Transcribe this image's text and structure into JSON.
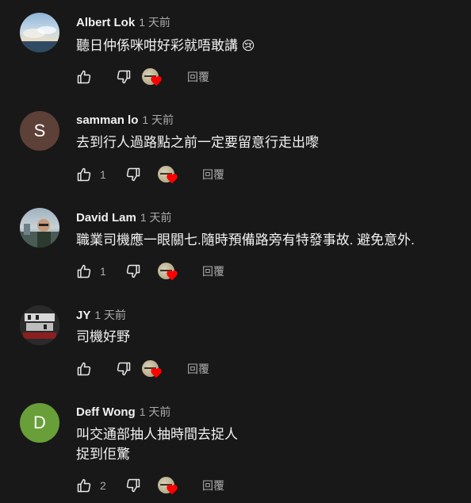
{
  "comments": [
    {
      "author": "Albert Lok",
      "time": "1 天前",
      "text_lines": [
        "聽日仲係咪咁好彩就唔敢講"
      ],
      "emoji": "😢",
      "likes": "",
      "avatar_letter": "",
      "reply_label": "回覆"
    },
    {
      "author": "samman lo",
      "time": "1 天前",
      "text_lines": [
        "去到行人過路點之前一定要留意行走出嚟"
      ],
      "emoji": "",
      "likes": "1",
      "avatar_letter": "S",
      "avatar_color": "#5d4037",
      "reply_label": "回覆"
    },
    {
      "author": "David Lam",
      "time": "1 天前",
      "text_lines": [
        "職業司機應一眼關七.隨時預備路旁有特發事故. 避免意外."
      ],
      "emoji": "",
      "likes": "1",
      "avatar_letter": "",
      "reply_label": "回覆"
    },
    {
      "author": "JY",
      "time": "1 天前",
      "text_lines": [
        "司機好野"
      ],
      "emoji": "",
      "likes": "",
      "avatar_letter": "",
      "reply_label": "回覆"
    },
    {
      "author": "Deff Wong",
      "time": "1 天前",
      "text_lines": [
        "叫交通部抽人抽時間去捉人",
        "捉到佢驚"
      ],
      "emoji": "",
      "likes": "2",
      "avatar_letter": "D",
      "avatar_color": "#689f38",
      "reply_label": "回覆"
    }
  ],
  "colors": {
    "background": "#181818",
    "heart": "#ff0000",
    "secondary_text": "#aaaaaa"
  },
  "icons": [
    "thumbs-up-icon",
    "thumbs-down-icon",
    "creator-heart-icon"
  ]
}
